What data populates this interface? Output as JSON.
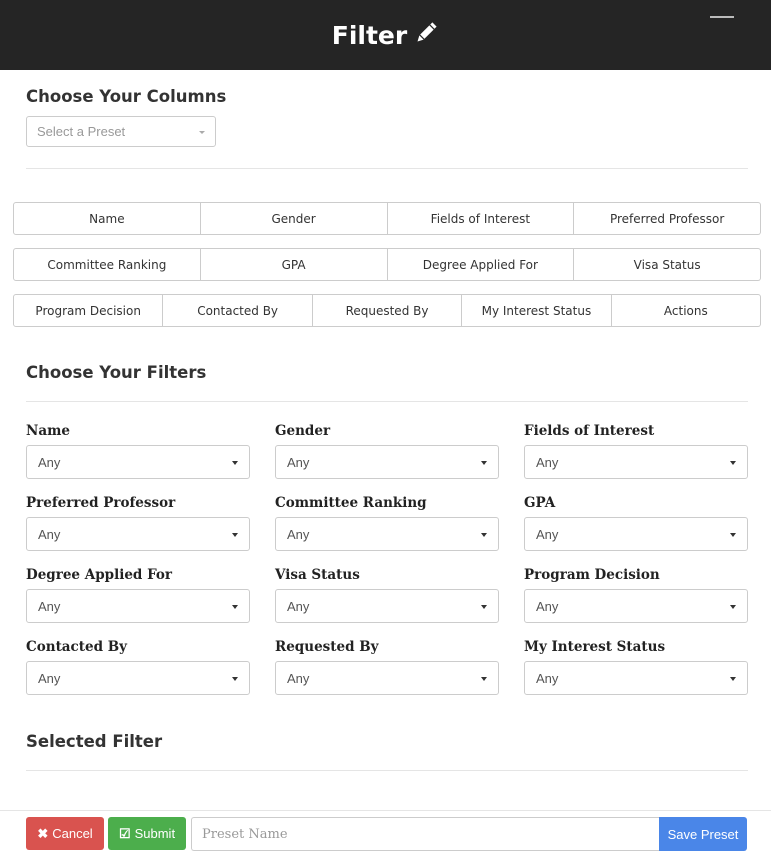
{
  "header": {
    "title": "Filter"
  },
  "columns": {
    "title": "Choose Your Columns",
    "preset_placeholder": "Select a Preset",
    "rows": [
      [
        "Name",
        "Gender",
        "Fields of Interest",
        "Preferred Professor"
      ],
      [
        "Committee Ranking",
        "GPA",
        "Degree Applied For",
        "Visa Status"
      ],
      [
        "Program Decision",
        "Contacted By",
        "Requested By",
        "My Interest Status",
        "Actions"
      ]
    ]
  },
  "filters": {
    "title": "Choose Your Filters",
    "items": [
      {
        "label": "Name",
        "value": "Any"
      },
      {
        "label": "Gender",
        "value": "Any"
      },
      {
        "label": "Fields of Interest",
        "value": "Any"
      },
      {
        "label": "Preferred Professor",
        "value": "Any"
      },
      {
        "label": "Committee Ranking",
        "value": "Any"
      },
      {
        "label": "GPA",
        "value": "Any"
      },
      {
        "label": "Degree Applied For",
        "value": "Any"
      },
      {
        "label": "Visa Status",
        "value": "Any"
      },
      {
        "label": "Program Decision",
        "value": "Any"
      },
      {
        "label": "Contacted By",
        "value": "Any"
      },
      {
        "label": "Requested By",
        "value": "Any"
      },
      {
        "label": "My Interest Status",
        "value": "Any"
      }
    ]
  },
  "selected": {
    "title": "Selected Filter"
  },
  "footer": {
    "cancel_label": "Cancel",
    "submit_label": "Submit",
    "preset_name_placeholder": "Preset Name",
    "save_label": "Save Preset"
  },
  "colors": {
    "header_bg": "#252525",
    "cancel": "#d9534f",
    "submit": "#4cae4c",
    "save": "#4a86e8"
  }
}
